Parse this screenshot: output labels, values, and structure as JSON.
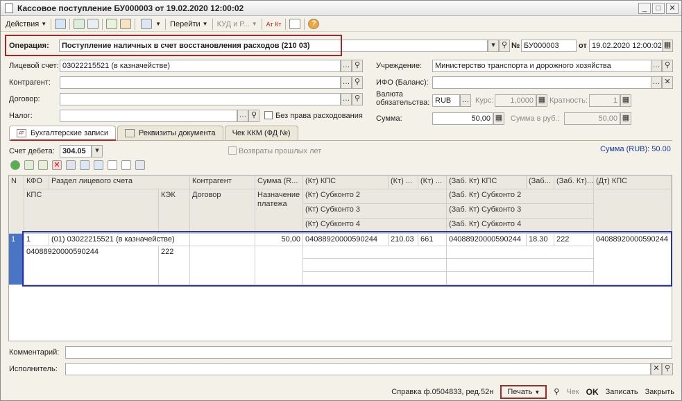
{
  "window": {
    "title": "Кассовое поступление БУ000003 от 19.02.2020 12:00:02"
  },
  "toolbar": {
    "actions": "Действия",
    "goto": "Перейти",
    "kud": "КУД и Р...",
    "atkt": "Ат Кт"
  },
  "header": {
    "operation_label": "Операция:",
    "operation_value": "Поступление наличных в счет восстановления расходов (210 03)",
    "num_label": "№",
    "num_value": "БУ000003",
    "date_label": "от",
    "date_value": "19.02.2020 12:00:02"
  },
  "left": {
    "account_label": "Лицевой счет:",
    "account_value": "03022215521 (в казначействе)",
    "counterparty_label": "Контрагент:",
    "contract_label": "Договор:",
    "tax_label": "Налог:",
    "norights_label": "Без права расходования"
  },
  "right": {
    "org_label": "Учреждение:",
    "org_value": "Министерство транспорта и дорожного хозяйства",
    "ifo_label": "ИФО (Баланс):",
    "currency_label": "Валюта обязательства:",
    "currency_value": "RUB",
    "rate_label": "Курс:",
    "rate_value": "1,0000",
    "mult_label": "Кратность:",
    "mult_value": "1",
    "sum_label": "Сумма:",
    "sum_value": "50,00",
    "sum_rub_label": "Сумма в руб.:",
    "sum_rub_value": "50,00"
  },
  "tabs": [
    "Бухгалтерские записи",
    "Реквизиты документа",
    "Чек ККМ (ФД №)"
  ],
  "entries": {
    "debit_label": "Счет дебета:",
    "debit_value": "304.05",
    "returns_label": "Возвраты прошлых лет",
    "sum_rub": "Сумма (RUB): 50.00"
  },
  "grid": {
    "headers": {
      "n": "N",
      "kfo": "КФО",
      "section": "Раздел лицевого счета",
      "counterparty": "Контрагент",
      "sum": "Сумма (R...",
      "kt_kps": "(Кт) КПС",
      "kt1": "(Кт) ...",
      "kt2": "(Кт) ...",
      "zab_kt_kps": "(Заб. Кт) КПС",
      "zab1": "(Заб...",
      "zab2": "(Заб. Кт)...",
      "dt_kps": "(Дт) КПС",
      "kps": "КПС",
      "kek": "КЭК",
      "contract": "Договор",
      "purpose": "Назначение платежа",
      "kt_sub2": "(Кт) Субконто 2",
      "kt_sub3": "(Кт) Субконто 3",
      "kt_sub4": "(Кт) Субконто 4",
      "zab_sub2": "(Заб. Кт) Субконто 2",
      "zab_sub3": "(Заб. Кт) Субконто 3",
      "zab_sub4": "(Заб. Кт) Субконто 4"
    },
    "row": {
      "n": "1",
      "kfo": "1",
      "section": "(01) 03022215521 (в казначействе)",
      "sum": "50,00",
      "kt_kps": "04088920000590244",
      "kt1": "210.03",
      "kt2": "661",
      "zab_kt_kps": "04088920000590244",
      "zab1": "18.30",
      "zab2": "222",
      "dt_kps": "04088920000590244",
      "kps": "04088920000590244",
      "kek": "222"
    }
  },
  "footer": {
    "comment_label": "Комментарий:",
    "executor_label": "Исполнитель:"
  },
  "statusbar": {
    "ref": "Справка ф.0504833, ред.52н",
    "print": "Печать",
    "check": "Чек",
    "ok": "OK",
    "save": "Записать",
    "close": "Закрыть"
  }
}
